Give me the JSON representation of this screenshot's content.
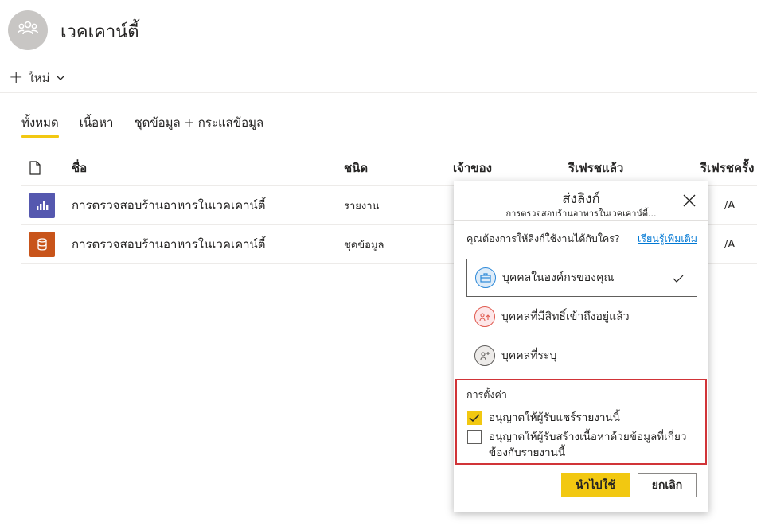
{
  "workspace": {
    "title": "เวคเคาน์ตี้",
    "icon": "people-group-icon"
  },
  "command_bar": {
    "new_label": "ใหม่"
  },
  "tabs": [
    {
      "label": "ทั้งหมด",
      "active": true
    },
    {
      "label": "เนื้อหา",
      "active": false
    },
    {
      "label": "ชุดข้อมูล + กระแสข้อมูล",
      "active": false
    }
  ],
  "table": {
    "columns": {
      "name": "ชื่อ",
      "type": "ชนิด",
      "owner": "เจ้าของ",
      "refreshed": "รีเฟรชแล้ว",
      "next_refresh": "รีเฟรชครั้ง"
    },
    "rows": [
      {
        "name": "การตรวจสอบร้านอาหารในเวคเคาน์ตี้",
        "type": "รายงาน",
        "icon": "report-bar-chart-icon",
        "icon_color": "#5558af",
        "next_refresh": "/A"
      },
      {
        "name": "การตรวจสอบร้านอาหารในเวคเคาน์ตี้",
        "type": "ชุดข้อมูล",
        "icon": "dataset-database-icon",
        "icon_color": "#c8541a",
        "next_refresh": "/A"
      }
    ]
  },
  "dialog": {
    "title": "ส่งลิงก์",
    "subtitle": "การตรวจสอบร้านอาหารในเวคเคาน์ตี้...",
    "question": "คุณต้องการให้ลิงก์ใช้งานได้กับใคร?",
    "learn_more": "เรียนรู้เพิ่มเติม",
    "options": [
      {
        "label": "บุคคลในองค์กรของคุณ",
        "selected": true,
        "icon": "briefcase-icon"
      },
      {
        "label": "บุคคลที่มีสิทธิ์เข้าถึงอยู่แล้ว",
        "selected": false,
        "icon": "people-access-icon"
      },
      {
        "label": "บุคคลที่ระบุ",
        "selected": false,
        "icon": "specific-people-icon"
      }
    ],
    "settings": {
      "title": "การตั้งค่า",
      "allow_reshare": {
        "label": "อนุญาตให้ผู้รับแชร์รายงานนี้",
        "checked": true
      },
      "allow_build_line1": "อนุญาตให้ผู้รับสร้างเนื้อหาด้วยข้อมูลที่เกี่ยว",
      "allow_build_line2": "ข้องกับรายงานนี้",
      "allow_build_checked": false
    },
    "apply_label": "นำไปใช้",
    "cancel_label": "ยกเลิก"
  },
  "colors": {
    "accent_yellow": "#f2c811",
    "highlight_red": "#d13438",
    "link_blue": "#0078d4"
  }
}
